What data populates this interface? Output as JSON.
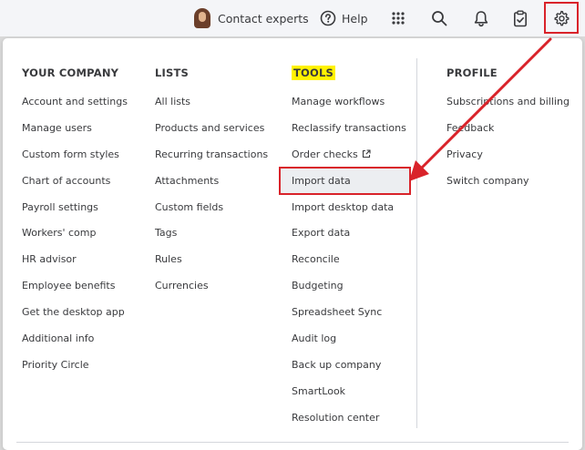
{
  "topbar": {
    "contact_label": "Contact experts",
    "help_label": "Help"
  },
  "columns": [
    {
      "heading": "YOUR COMPANY",
      "items": [
        "Account and settings",
        "Manage users",
        "Custom form styles",
        "Chart of accounts",
        "Payroll settings",
        "Workers' comp",
        "HR advisor",
        "Employee benefits",
        "Get the desktop app",
        "Additional info",
        "Priority Circle"
      ]
    },
    {
      "heading": "LISTS",
      "items": [
        "All lists",
        "Products and services",
        "Recurring transactions",
        "Attachments",
        "Custom fields",
        "Tags",
        "Rules",
        "Currencies"
      ]
    },
    {
      "heading": "TOOLS",
      "items": [
        "Manage workflows",
        "Reclassify transactions",
        "Order checks",
        "Import data",
        "Import desktop data",
        "Export data",
        "Reconcile",
        "Budgeting",
        "Spreadsheet Sync",
        "Audit log",
        "Back up company",
        "SmartLook",
        "Resolution center"
      ]
    },
    {
      "heading": "PROFILE",
      "items": [
        "Subscriptions and billing",
        "Feedback",
        "Privacy",
        "Switch company"
      ]
    }
  ],
  "colors": {
    "annotation_red": "#d9232a",
    "highlight_yellow": "#fff200",
    "text": "#393a3d"
  },
  "icons": [
    "avatar",
    "help-icon",
    "apps-grid-icon",
    "search-icon",
    "bell-icon",
    "clipboard-icon",
    "gear-icon",
    "external-link-icon",
    "annotation-arrow"
  ]
}
